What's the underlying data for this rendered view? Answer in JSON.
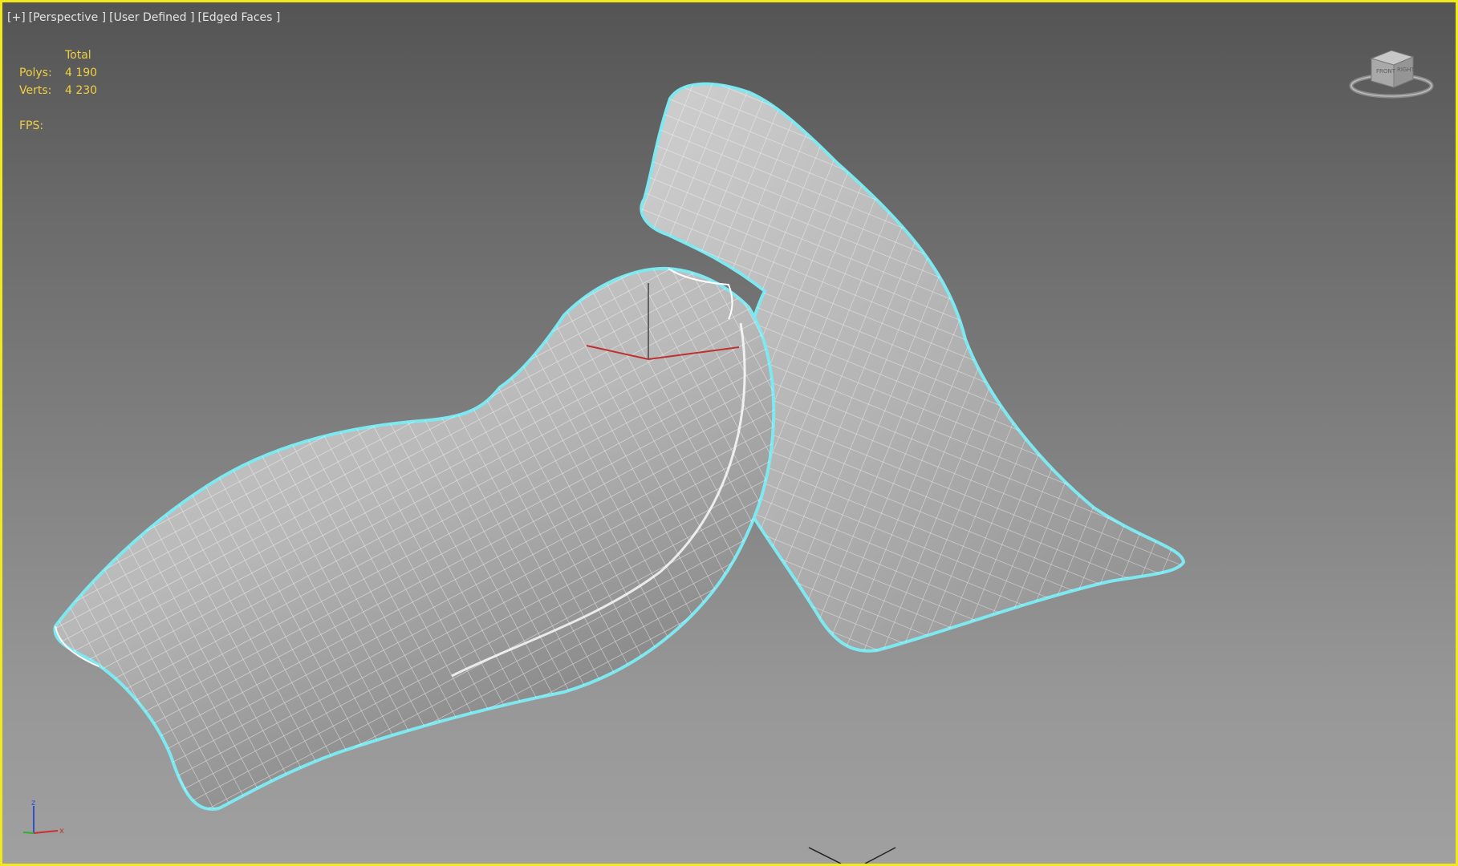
{
  "viewport": {
    "labels": [
      "[+]",
      "[Perspective ]",
      "[User Defined ]",
      "[Edged Faces ]"
    ],
    "border_color": "#f2e81e",
    "selection_outline_color": "#7ee8f0",
    "stats_color": "#f0d040"
  },
  "stats": {
    "header": "Total",
    "polys_label": "Polys:",
    "polys_value": "4 190",
    "verts_label": "Verts:",
    "verts_value": "4 230",
    "fps_label": "FPS:"
  },
  "viewcube": {
    "icon": "viewcube-icon",
    "face_front": "FRONT",
    "face_right": "RIGHT"
  },
  "axis_tripod": {
    "icon": "axis-tripod-icon",
    "x": "x",
    "z": "z"
  }
}
